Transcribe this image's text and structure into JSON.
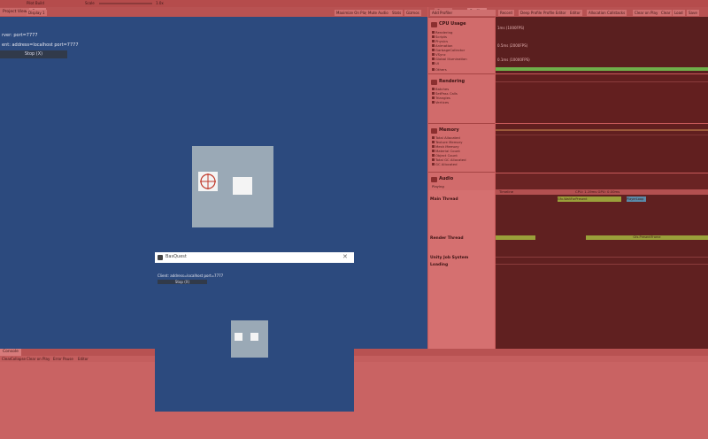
{
  "top_menu": {
    "left_items": [
      "",
      "Pilot Build"
    ],
    "zoom_label": "Scale",
    "zoom_value": "1.0x"
  },
  "game_tabs": [
    "Project Views",
    "Game"
  ],
  "game_toolbar": {
    "display": "Display 1",
    "buttons": [
      "Maximize On Play",
      "Mute Audio",
      "Stats",
      "Gizmos"
    ]
  },
  "profiler_tabs": [
    "Scene",
    "Profiler"
  ],
  "profiler_toolbar": {
    "add_profiler": "Add Profiler",
    "buttons": [
      "Record",
      "Deep Profile",
      "Profile Editor",
      "Editor",
      "Allocation Callstacks",
      "Clear on Play",
      "Clear",
      "Load",
      "Save"
    ]
  },
  "game_view": {
    "line1": "rver: port=7777",
    "line2": "ent: address=localhost port=7777",
    "stop_button": "Stop (X)"
  },
  "profiler": {
    "cpu": {
      "title": "CPU Usage",
      "items": [
        "Rendering",
        "Scripts",
        "Physics",
        "Animation",
        "GarbageCollector",
        "VSync",
        "Global Illumination",
        "UI",
        "Others"
      ],
      "labels": [
        "1ms (1000FPS)",
        "0.5ms (2000FPS)",
        "0.1ms (10000FPS)"
      ]
    },
    "rendering": {
      "title": "Rendering",
      "items": [
        "Batches",
        "SetPass Calls",
        "Triangles",
        "Vertices"
      ]
    },
    "memory": {
      "title": "Memory",
      "items": [
        "Total Allocated",
        "Texture Memory",
        "Mesh Memory",
        "Material Count",
        "Object Count",
        "Total GC Allocated",
        "GC Allocated"
      ]
    },
    "audio": {
      "title": "Audio",
      "items": [
        "Playing"
      ]
    },
    "timeline": {
      "header_left": "Timeline",
      "header_frame": "CPU: 1.19ms  GPU: 0.00ms",
      "threads": [
        "Main Thread",
        "Render Thread",
        "Unity Job System",
        "Loading"
      ],
      "main_label": "PlayerLoop",
      "main_label2": "Gfx.WaitForPresent",
      "render_label": "Gfx.PresentFrame"
    }
  },
  "console": {
    "tab": "Console",
    "buttons": [
      "Clear",
      "Collapse",
      "Clear on Play",
      "Error Pause",
      "Editor"
    ]
  },
  "dialog": {
    "title": "BasQuest",
    "text": "Client: address=localhost port=7777",
    "stop_button": "Stop (X)",
    "close": "✕"
  },
  "colors": {
    "game_bg": "#2c4a7e",
    "editor_tint": "#c85a5a",
    "graph_bg": "#5a1f1f",
    "cpu_line": "#6fae4a"
  }
}
